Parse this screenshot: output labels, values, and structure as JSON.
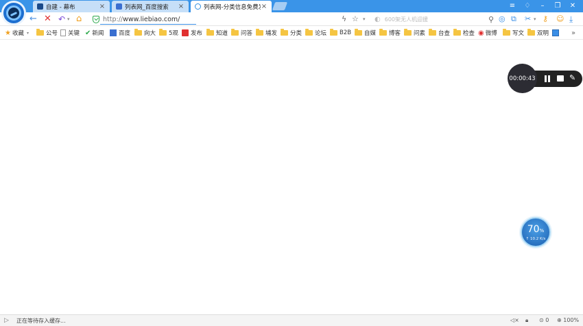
{
  "tabs": [
    {
      "label": "自建 - 幕布",
      "fav_color": "#1a4a8a"
    },
    {
      "label": "列表网_百度搜索",
      "fav_color": "#3a6fd0"
    },
    {
      "label": "列表网-分类信息免费发",
      "fav_color": "#2f8fe0"
    }
  ],
  "address": {
    "protocol": "http://",
    "host": "www.liebiao.com/"
  },
  "search": {
    "placeholder": "600架无人机迎援"
  },
  "bookmarks": [
    {
      "label": "收藏"
    },
    {
      "label": "公号"
    },
    {
      "label": "关键"
    },
    {
      "label": "新闻"
    },
    {
      "label": "百度"
    },
    {
      "label": "向大"
    },
    {
      "label": "5观"
    },
    {
      "label": "发布"
    },
    {
      "label": "知道"
    },
    {
      "label": "问答"
    },
    {
      "label": "埔发"
    },
    {
      "label": "分类"
    },
    {
      "label": "论坛"
    },
    {
      "label": "B2B"
    },
    {
      "label": "自媒"
    },
    {
      "label": "博客"
    },
    {
      "label": "问素"
    },
    {
      "label": "台查"
    },
    {
      "label": "检查"
    },
    {
      "label": "微博"
    },
    {
      "label": "写文"
    },
    {
      "label": "双明"
    }
  ],
  "recorder": {
    "time": "00:00:43"
  },
  "speed": {
    "percent": "70",
    "unit": "%",
    "rate": "↑ 10.2 K/s"
  },
  "status": {
    "text": "正在等待存入缓存...",
    "downloads": "0",
    "zoom": "100%"
  }
}
